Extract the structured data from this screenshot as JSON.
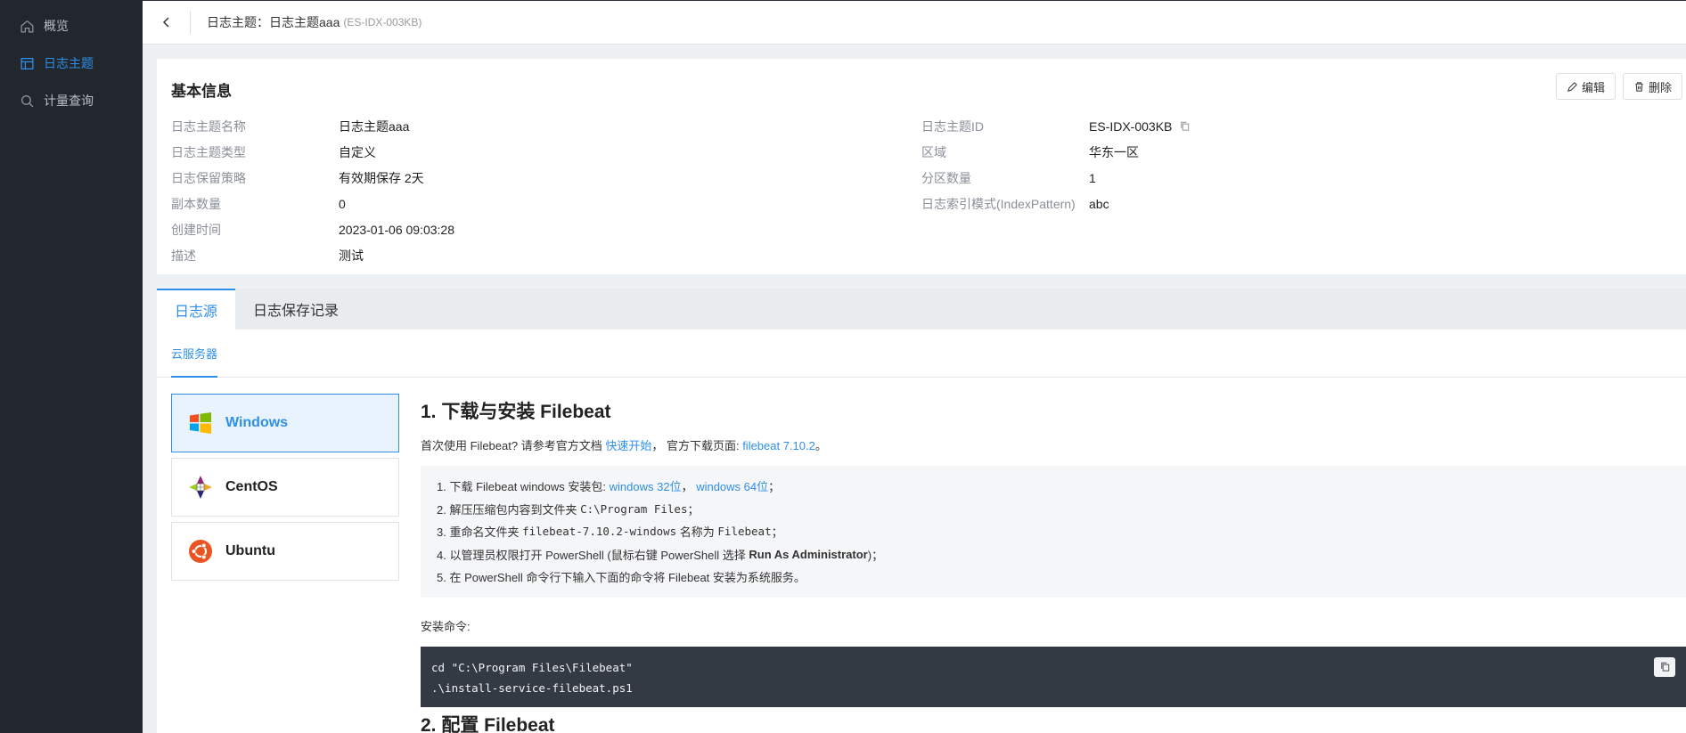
{
  "sidebar": {
    "items": [
      {
        "label": "概览",
        "icon": "home-icon",
        "active": false
      },
      {
        "label": "日志主题",
        "icon": "layout-icon",
        "active": true
      },
      {
        "label": "计量查询",
        "icon": "search-icon",
        "active": false
      }
    ]
  },
  "header": {
    "title": "日志主题：日志主题aaa",
    "subtitle": "(ES-IDX-003KB)"
  },
  "basic_info": {
    "title": "基本信息",
    "edit_label": "编辑",
    "delete_label": "删除",
    "left": [
      {
        "label": "日志主题名称",
        "value": "日志主题aaa"
      },
      {
        "label": "日志主题类型",
        "value": "自定义"
      },
      {
        "label": "日志保留策略",
        "value": "有效期保存 2天"
      },
      {
        "label": "副本数量",
        "value": "0"
      },
      {
        "label": "创建时间",
        "value": "2023-01-06 09:03:28"
      },
      {
        "label": "描述",
        "value": "测试"
      }
    ],
    "right": [
      {
        "label": "日志主题ID",
        "value": "ES-IDX-003KB"
      },
      {
        "label": "区域",
        "value": "华东一区"
      },
      {
        "label": "分区数量",
        "value": "1"
      },
      {
        "label": "日志索引模式(IndexPattern)",
        "value": "abc"
      }
    ]
  },
  "tabs": [
    {
      "label": "日志源",
      "active": true
    },
    {
      "label": "日志保存记录",
      "active": false
    }
  ],
  "subtab": "云服务器",
  "os_list": [
    {
      "label": "Windows",
      "active": true
    },
    {
      "label": "CentOS",
      "active": false
    },
    {
      "label": "Ubuntu",
      "active": false
    }
  ],
  "doc": {
    "heading1": "1. 下载与安装 Filebeat",
    "intro_a": "首次使用 Filebeat? 请参考官方文档 ",
    "intro_link1": "快速开始",
    "intro_b": "， 官方下载页面: ",
    "intro_link2": "filebeat 7.10.2",
    "intro_c": "。",
    "step1_a": "1. 下载 Filebeat windows 安装包: ",
    "step1_link1": "windows 32位",
    "step1_sep": "， ",
    "step1_link2": "windows 64位",
    "step1_end": "；",
    "step2_a": "2. 解压压缩包内容到文件夹 ",
    "step2_code": "C:\\Program Files",
    "step2_end": "；",
    "step3_a": "3. 重命名文件夹 ",
    "step3_code1": "filebeat-7.10.2-windows",
    "step3_b": " 名称为 ",
    "step3_code2": "Filebeat",
    "step3_end": "；",
    "step4_a": "4. 以管理员权限打开 PowerShell (鼠标右键 PowerShell 选择 ",
    "step4_bold": "Run As Administrator",
    "step4_end": ")；",
    "step5": "5. 在 PowerShell 命令行下输入下面的命令将 Filebeat 安装为系统服务。",
    "cmd_label": "安装命令:",
    "code_line1": "cd \"C:\\Program Files\\Filebeat\"",
    "code_line2": ".\\install-service-filebeat.ps1",
    "heading2": "2. 配置 Filebeat"
  },
  "colors": {
    "accent": "#2f8fe8",
    "sidebar_bg": "#22262d",
    "code_bg": "#333a44"
  }
}
